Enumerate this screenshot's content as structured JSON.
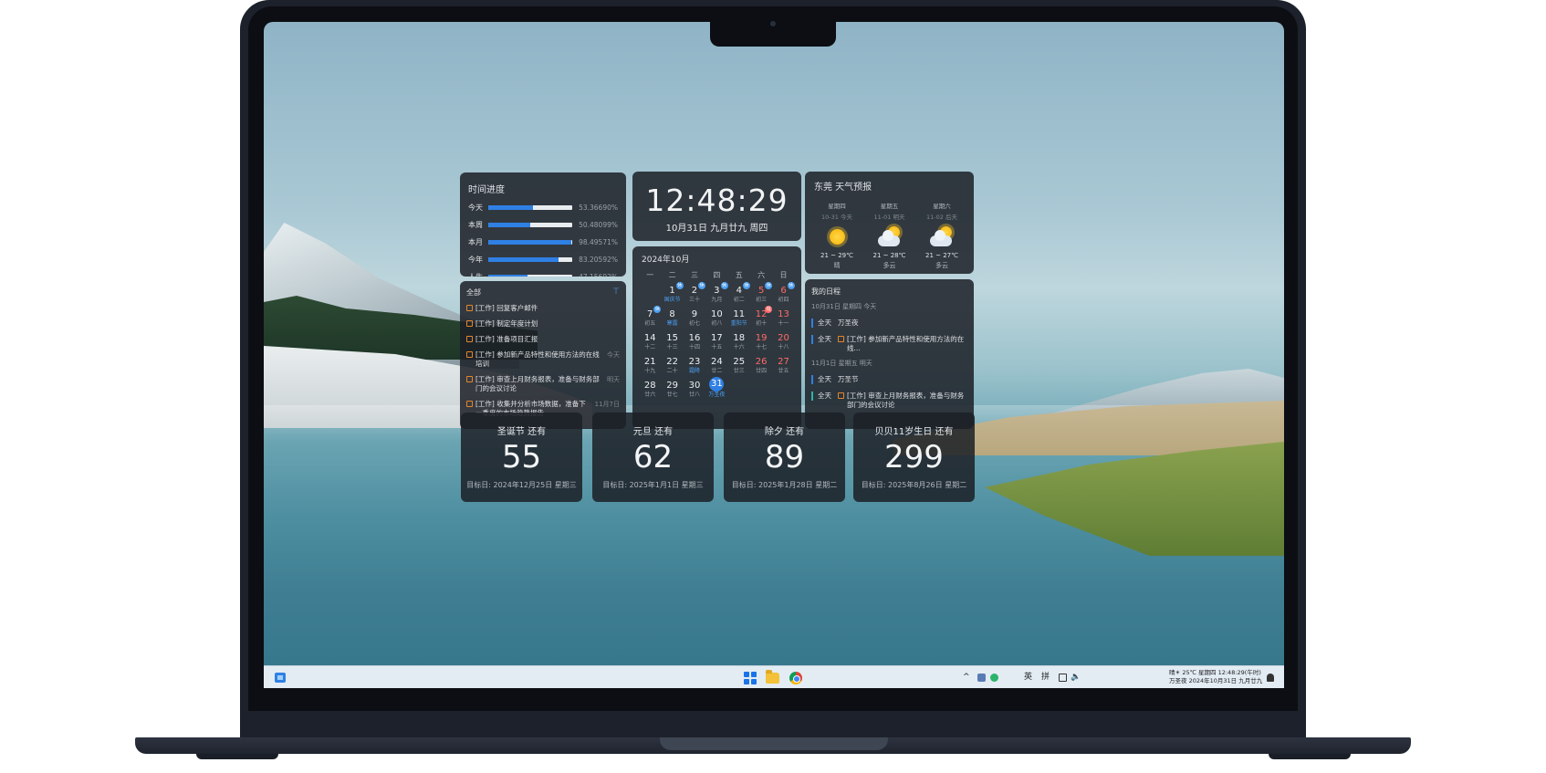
{
  "progress": {
    "title": "时间进度",
    "rows": [
      {
        "label": "今天",
        "percent_text": "53.36690%",
        "value": 53.3669
      },
      {
        "label": "本周",
        "percent_text": "50.48099%",
        "value": 50.48099
      },
      {
        "label": "本月",
        "percent_text": "98.49571%",
        "value": 98.49571
      },
      {
        "label": "今年",
        "percent_text": "83.20592%",
        "value": 83.20592
      },
      {
        "label": "人生",
        "percent_text": "47.15692%",
        "value": 47.15692
      }
    ]
  },
  "clock": {
    "time": "12:48:29",
    "date": "10月31日 九月廿九 周四"
  },
  "weather": {
    "title": "东莞 天气预报",
    "days": [
      {
        "weekday": "星期四",
        "date": "10-31 今天",
        "icon": "sun-icon",
        "temp": "21 ~ 29℃",
        "condition": "晴"
      },
      {
        "weekday": "星期五",
        "date": "11-01 明天",
        "icon": "partly-cloudy-icon",
        "temp": "21 ~ 28℃",
        "condition": "多云"
      },
      {
        "weekday": "星期六",
        "date": "11-02 后天",
        "icon": "partly-cloudy-icon",
        "temp": "21 ~ 27℃",
        "condition": "多云"
      }
    ]
  },
  "calendar": {
    "month_label": "2024年10月",
    "weekdays": [
      "一",
      "二",
      "三",
      "四",
      "五",
      "六",
      "日"
    ],
    "days": [
      {
        "n": "",
        "l": ""
      },
      {
        "n": "1",
        "l": "国庆节",
        "lunar_blue": true,
        "badge": "休"
      },
      {
        "n": "2",
        "l": "三十",
        "badge": "休"
      },
      {
        "n": "3",
        "l": "九月",
        "badge": "休"
      },
      {
        "n": "4",
        "l": "初二",
        "badge": "休"
      },
      {
        "n": "5",
        "l": "初三",
        "red": true,
        "badge": "休"
      },
      {
        "n": "6",
        "l": "初四",
        "red": true,
        "badge": "休"
      },
      {
        "n": "7",
        "l": "初五",
        "badge": "休"
      },
      {
        "n": "8",
        "l": "寒露",
        "lunar_blue": true
      },
      {
        "n": "9",
        "l": "初七"
      },
      {
        "n": "10",
        "l": "初八"
      },
      {
        "n": "11",
        "l": "重阳节",
        "lunar_blue": true
      },
      {
        "n": "12",
        "l": "初十",
        "red": true,
        "badge": "班",
        "badge_red": true
      },
      {
        "n": "13",
        "l": "十一",
        "red": true
      },
      {
        "n": "14",
        "l": "十二"
      },
      {
        "n": "15",
        "l": "十三"
      },
      {
        "n": "16",
        "l": "十四"
      },
      {
        "n": "17",
        "l": "十五"
      },
      {
        "n": "18",
        "l": "十六"
      },
      {
        "n": "19",
        "l": "十七",
        "red": true
      },
      {
        "n": "20",
        "l": "十八",
        "red": true
      },
      {
        "n": "21",
        "l": "十九"
      },
      {
        "n": "22",
        "l": "二十"
      },
      {
        "n": "23",
        "l": "霜降",
        "lunar_blue": true
      },
      {
        "n": "24",
        "l": "廿二"
      },
      {
        "n": "25",
        "l": "廿三"
      },
      {
        "n": "26",
        "l": "廿四",
        "red": true
      },
      {
        "n": "27",
        "l": "廿五",
        "red": true
      },
      {
        "n": "28",
        "l": "廿六"
      },
      {
        "n": "29",
        "l": "廿七"
      },
      {
        "n": "30",
        "l": "廿八"
      },
      {
        "n": "31",
        "l": "万圣夜",
        "lunar_blue": true,
        "today": true
      }
    ]
  },
  "todo": {
    "title": "全部",
    "items": [
      {
        "text": "[工作] 回复客户邮件",
        "due": ""
      },
      {
        "text": "[工作] 制定年度计划",
        "due": ""
      },
      {
        "text": "[工作] 准备项目汇报",
        "due": ""
      },
      {
        "text": "[工作] 参加新产品特性和使用方法的在线培训",
        "due": "今天"
      },
      {
        "text": "[工作] 审查上月财务报表，准备与财务部门的会议讨论",
        "due": "明天"
      },
      {
        "text": "[工作] 收集并分析市场数据，准备下一季度的市场趋势报告",
        "due": "11月7日"
      }
    ]
  },
  "schedule": {
    "title": "我的日程",
    "groups": [
      {
        "day": "10月31日 星期四 今天",
        "events": [
          {
            "allday": "全天",
            "text": "万圣夜",
            "checkbox": false
          },
          {
            "allday": "全天",
            "text": "[工作] 参加新产品特性和使用方法的在线...",
            "checkbox": true
          }
        ]
      },
      {
        "day": "11月1日 星期五 明天",
        "events": [
          {
            "allday": "全天",
            "text": "万圣节",
            "checkbox": false
          },
          {
            "allday": "全天",
            "text": "[工作] 审查上月财务报表，准备与财务部门的会议讨论",
            "checkbox": true,
            "teal": true
          }
        ]
      }
    ]
  },
  "countdowns": [
    {
      "label": "圣诞节 还有",
      "days": "55",
      "target": "目标日: 2024年12月25日 星期三"
    },
    {
      "label": "元旦 还有",
      "days": "62",
      "target": "目标日: 2025年1月1日 星期三"
    },
    {
      "label": "除夕 还有",
      "days": "89",
      "target": "目标日: 2025年1月28日 星期二"
    },
    {
      "label": "贝贝11岁生日 还有",
      "days": "299",
      "target": "目标日: 2025年8月26日 星期二"
    }
  ],
  "taskbar": {
    "ime_lang": "英",
    "ime_mode": "拼",
    "clock_line1": "晴☀ 25℃ 星期四 12:48:29(午时)",
    "clock_line2": "万圣夜 2024年10月31日 九月廿九"
  }
}
